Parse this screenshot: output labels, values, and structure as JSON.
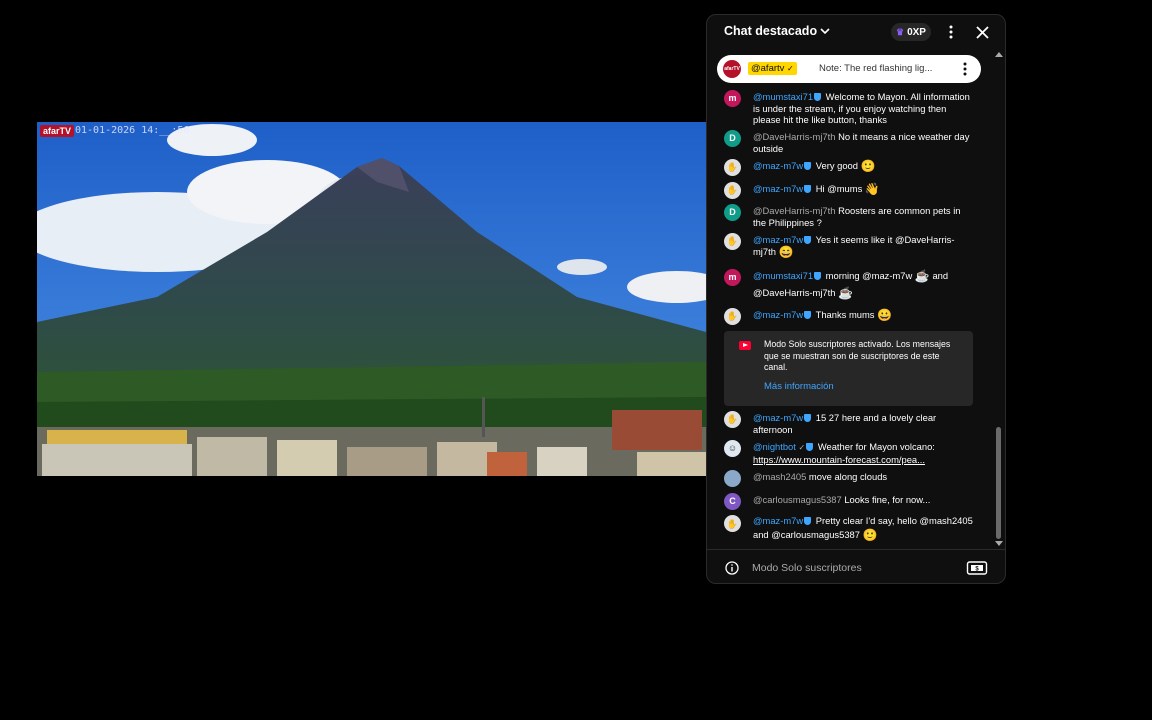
{
  "video": {
    "watermark_logo": "afarTV",
    "watermark_time": "01-01-2026 14:__:56"
  },
  "chat": {
    "title": "Chat destacado",
    "xp": "0XP",
    "pinned": {
      "avatar": "afarTV",
      "author": "@afartv",
      "text": "Note: The red flashing lig..."
    },
    "messages": [
      {
        "avatar": "m",
        "avatar_color": "#c2185b",
        "author": "@mumstaxi71",
        "verified": true,
        "text": "Welcome to Mayon. All information is under the stream, if you enjoy watching then please hit the like button, thanks"
      },
      {
        "avatar": "D",
        "avatar_color": "#0f9d8a",
        "author": "@DaveHarris-mj7th",
        "verified": false,
        "text": "No it means a nice weather day outside"
      },
      {
        "avatar": "",
        "avatar_color": "#e0e0e0",
        "author": "@maz-m7w",
        "verified": true,
        "text": "Very good",
        "emoji": "🙂"
      },
      {
        "avatar": "",
        "avatar_color": "#e0e0e0",
        "author": "@maz-m7w",
        "verified": true,
        "text": "Hi @mums",
        "emoji": "👋"
      },
      {
        "avatar": "D",
        "avatar_color": "#0f9d8a",
        "author": "@DaveHarris-mj7th",
        "verified": false,
        "text": "Roosters are common pets in the Philippines ?"
      },
      {
        "avatar": "",
        "avatar_color": "#e0e0e0",
        "author": "@maz-m7w",
        "verified": true,
        "text": "Yes it seems like it @DaveHarris-mj7th",
        "emoji": "😄"
      },
      {
        "avatar": "m",
        "avatar_color": "#c2185b",
        "author": "@mumstaxi71",
        "verified": true,
        "text": "morning @maz-m7w",
        "emoji": "☕",
        "text2": "and @DaveHarris-mj7th",
        "emoji2": "☕"
      },
      {
        "avatar": "",
        "avatar_color": "#e0e0e0",
        "author": "@maz-m7w",
        "verified": true,
        "text": "Thanks mums",
        "emoji": "😀"
      },
      {
        "avatar": "",
        "avatar_color": "#e0e0e0",
        "author": "@maz-m7w",
        "verified": true,
        "text": "15 27 here and a lovely clear afternoon"
      },
      {
        "avatar": "",
        "avatar_color": "#e0e0e0",
        "author": "@nightbot",
        "verified": true,
        "text": "Weather for Mayon volcano:",
        "link": "https://www.mountain-forecast.com/pea..."
      },
      {
        "avatar": "",
        "avatar_color": "#8aa8c8",
        "author": "@mash2405",
        "verified": false,
        "text": "move along clouds"
      },
      {
        "avatar": "C",
        "avatar_color": "#7e57c2",
        "author": "@carlousmagus5387",
        "verified": false,
        "text": "Looks fine, for now..."
      },
      {
        "avatar": "",
        "avatar_color": "#e0e0e0",
        "author": "@maz-m7w",
        "verified": true,
        "text": "Pretty clear I'd say, hello @mash2405 and @carlousmagus5387",
        "emoji": "🙂"
      }
    ],
    "notice": {
      "text": "Modo Solo suscriptores activado. Los mensajes que se muestran son de suscriptores de este canal.",
      "link": "Más información"
    },
    "footer": {
      "text": "Modo Solo suscriptores"
    }
  }
}
